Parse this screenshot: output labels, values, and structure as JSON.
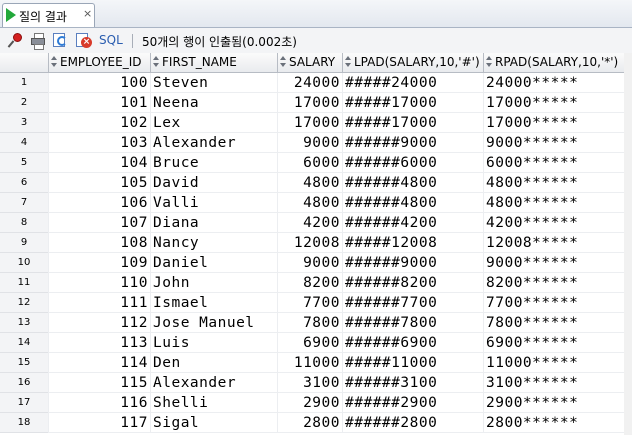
{
  "tab": {
    "label": "질의 결과",
    "close": "×"
  },
  "toolbar": {
    "sql_label": "SQL",
    "status": "50개의 행이 인출됨(0.002초)"
  },
  "columns": [
    "EMPLOYEE_ID",
    "FIRST_NAME",
    "SALARY",
    "LPAD(SALARY,10,'#')",
    "RPAD(SALARY,10,'*')"
  ],
  "rows": [
    {
      "n": "1",
      "id": "100",
      "first_name": "Steven",
      "salary": "24000",
      "lpad": "#####24000",
      "rpad": "24000*****"
    },
    {
      "n": "2",
      "id": "101",
      "first_name": "Neena",
      "salary": "17000",
      "lpad": "#####17000",
      "rpad": "17000*****"
    },
    {
      "n": "3",
      "id": "102",
      "first_name": "Lex",
      "salary": "17000",
      "lpad": "#####17000",
      "rpad": "17000*****"
    },
    {
      "n": "4",
      "id": "103",
      "first_name": "Alexander",
      "salary": "9000",
      "lpad": "######9000",
      "rpad": "9000******"
    },
    {
      "n": "5",
      "id": "104",
      "first_name": "Bruce",
      "salary": "6000",
      "lpad": "######6000",
      "rpad": "6000******"
    },
    {
      "n": "6",
      "id": "105",
      "first_name": "David",
      "salary": "4800",
      "lpad": "######4800",
      "rpad": "4800******"
    },
    {
      "n": "7",
      "id": "106",
      "first_name": "Valli",
      "salary": "4800",
      "lpad": "######4800",
      "rpad": "4800******"
    },
    {
      "n": "8",
      "id": "107",
      "first_name": "Diana",
      "salary": "4200",
      "lpad": "######4200",
      "rpad": "4200******"
    },
    {
      "n": "9",
      "id": "108",
      "first_name": "Nancy",
      "salary": "12008",
      "lpad": "#####12008",
      "rpad": "12008*****"
    },
    {
      "n": "10",
      "id": "109",
      "first_name": "Daniel",
      "salary": "9000",
      "lpad": "######9000",
      "rpad": "9000******"
    },
    {
      "n": "11",
      "id": "110",
      "first_name": "John",
      "salary": "8200",
      "lpad": "######8200",
      "rpad": "8200******"
    },
    {
      "n": "12",
      "id": "111",
      "first_name": "Ismael",
      "salary": "7700",
      "lpad": "######7700",
      "rpad": "7700******"
    },
    {
      "n": "13",
      "id": "112",
      "first_name": "Jose Manuel",
      "salary": "7800",
      "lpad": "######7800",
      "rpad": "7800******"
    },
    {
      "n": "14",
      "id": "113",
      "first_name": "Luis",
      "salary": "6900",
      "lpad": "######6900",
      "rpad": "6900******"
    },
    {
      "n": "15",
      "id": "114",
      "first_name": "Den",
      "salary": "11000",
      "lpad": "#####11000",
      "rpad": "11000*****"
    },
    {
      "n": "16",
      "id": "115",
      "first_name": "Alexander",
      "salary": "3100",
      "lpad": "######3100",
      "rpad": "3100******"
    },
    {
      "n": "17",
      "id": "116",
      "first_name": "Shelli",
      "salary": "2900",
      "lpad": "######2900",
      "rpad": "2900******"
    },
    {
      "n": "18",
      "id": "117",
      "first_name": "Sigal",
      "salary": "2800",
      "lpad": "######2800",
      "rpad": "2800******"
    }
  ]
}
